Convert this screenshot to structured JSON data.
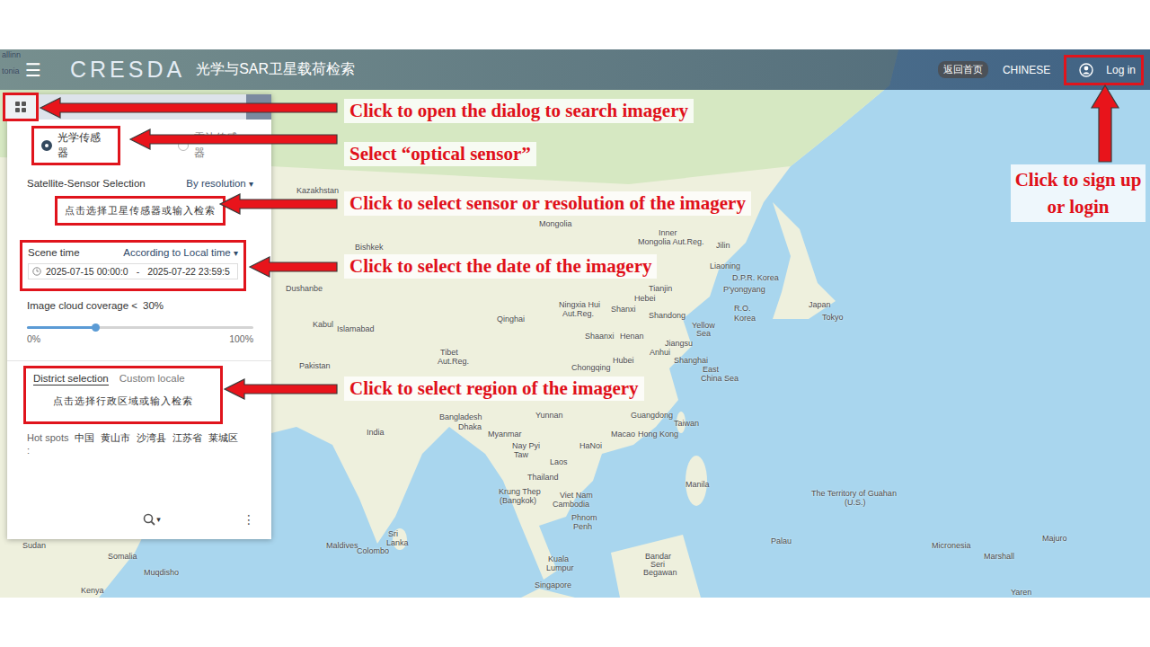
{
  "header": {
    "menu_icon": "☰",
    "logo": "CRESDA",
    "title": "光学与SAR卫星载荷检索",
    "home_button": "返回首页",
    "language": "CHINESE",
    "login": "Log in"
  },
  "search_panel": {
    "sensor_types": [
      {
        "label": "光学传感器",
        "selected": true
      },
      {
        "label": "雷达传感器",
        "selected": false
      }
    ],
    "satellite_sensor": {
      "label": "Satellite-Sensor Selection",
      "mode": "By resolution",
      "caret": "▾",
      "placeholder": "点击选择卫星传感器或输入检索"
    },
    "scene_time": {
      "label": "Scene time",
      "mode": "According to Local time",
      "caret": "▾",
      "start": "2025-07-15 00:00:0",
      "separator": "-",
      "end": "2025-07-22 23:59:5"
    },
    "cloud": {
      "label": "Image cloud coverage <",
      "value": "30%",
      "level": 0.3,
      "min": "0%",
      "max": "100%"
    },
    "region_tabs": [
      {
        "label": "District selection",
        "selected": true
      },
      {
        "label": "Custom locale",
        "selected": false
      }
    ],
    "region_placeholder": "点击选择行政区域或输入检索",
    "hot_spots": {
      "label": "Hot spots",
      "colon": ":",
      "items": [
        "中国",
        "黄山市",
        "沙湾县",
        "江苏省",
        "莱城区"
      ]
    },
    "search_caret": "▾",
    "more_icon": "⋮"
  },
  "annotations": [
    "Click to open the dialog to search imagery",
    "Select “optical sensor”",
    "Click to select sensor or resolution of the imagery",
    "Click to select the date of the imagery",
    "Click to select region of the imagery",
    "Click to sign up or login"
  ],
  "map": {
    "labels": [
      "allinn",
      "tonia",
      "Kazakhstan",
      "Bishkek",
      "Dushanbe",
      "Kabul",
      "Islamabad",
      "Pakistan",
      "Mongolia",
      "Inner",
      "Mongolia Aut.Reg.",
      "Jilin",
      "Liaoning",
      "D.P.R. Korea",
      "P'yongyang",
      "R.O.",
      "Korea",
      "Japan",
      "Tokyo",
      "Tianjin",
      "Hebei",
      "Ningxia Hui",
      "Aut.Reg.",
      "Shanxi",
      "Shandong",
      "Qinghai",
      "Yellow",
      "Sea",
      "Tibet",
      "Aut.Reg.",
      "Shaanxi",
      "Henan",
      "Jiangsu",
      "Anhui",
      "Shanghai",
      "Hubei",
      "Chongqing",
      "East",
      "China Sea",
      "India",
      "Bangladesh",
      "Dhaka",
      "Yunnan",
      "Guangdong",
      "Taiwan",
      "Macao",
      "Hong Kong",
      "Myanmar",
      "Nay Pyi",
      "Taw",
      "HaNoi",
      "Laos",
      "Thailand",
      "Krung Thep",
      "(Bangkok)",
      "Viet Nam",
      "Cambodia",
      "Phnom",
      "Penh",
      "Manila",
      "The Territory of Guahan",
      "(U.S.)",
      "Palau",
      "Micronesia",
      "Majuro",
      "Marshall",
      "Yaren",
      "Maldives",
      "Sri",
      "Lanka",
      "Colombo",
      "Kuala",
      "Lumpur",
      "Singapore",
      "Bandar",
      "Seri",
      "Begawan",
      "Sudan",
      "Somalia",
      "Muqdisho",
      "Kenya"
    ]
  }
}
